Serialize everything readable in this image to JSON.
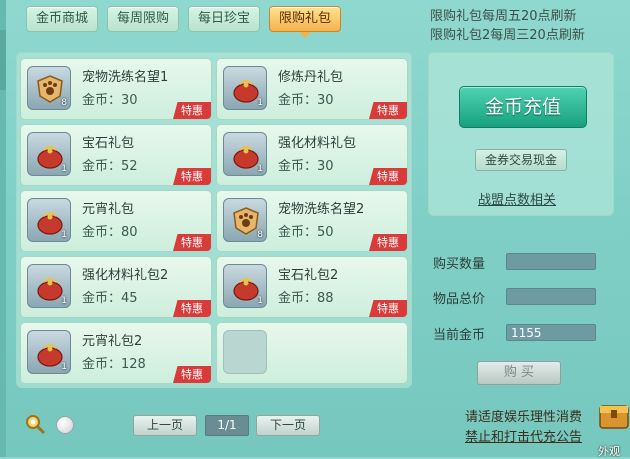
{
  "tabs": [
    {
      "label": "金币商城",
      "active": false
    },
    {
      "label": "每周限购",
      "active": false
    },
    {
      "label": "每日珍宝",
      "active": false
    },
    {
      "label": "限购礼包",
      "active": true
    }
  ],
  "notice": {
    "line1": "限购礼包每周五20点刷新",
    "line2": "限购礼包2每周三20点刷新"
  },
  "items": [
    {
      "name": "宠物洗练名望1",
      "price": "金币：30",
      "count": "8",
      "tag": "特惠",
      "icon": "pet-badge-icon"
    },
    {
      "name": "修炼丹礼包",
      "price": "金币：30",
      "count": "1",
      "tag": "特惠",
      "icon": "gift-bag-icon"
    },
    {
      "name": "宝石礼包",
      "price": "金币：52",
      "count": "1",
      "tag": "特惠",
      "icon": "gift-bag-icon"
    },
    {
      "name": "强化材料礼包",
      "price": "金币：30",
      "count": "1",
      "tag": "特惠",
      "icon": "gift-bag-icon"
    },
    {
      "name": "元宵礼包",
      "price": "金币：80",
      "count": "1",
      "tag": "特惠",
      "icon": "gift-bag-icon"
    },
    {
      "name": "宠物洗练名望2",
      "price": "金币：50",
      "count": "8",
      "tag": "特惠",
      "icon": "pet-badge-icon"
    },
    {
      "name": "强化材料礼包2",
      "price": "金币：45",
      "count": "1",
      "tag": "特惠",
      "icon": "gift-bag-icon"
    },
    {
      "name": "宝石礼包2",
      "price": "金币：88",
      "count": "1",
      "tag": "特惠",
      "icon": "gift-bag-icon"
    },
    {
      "name": "元宵礼包2",
      "price": "金币：128",
      "count": "1",
      "tag": "特惠",
      "icon": "gift-bag-icon"
    }
  ],
  "right_panel": {
    "recharge_label": "金币充值",
    "voucher_label": "金券交易现金",
    "league_label": "战盟点数相关"
  },
  "purchase": {
    "qty_label": "购买数量",
    "qty_value": "",
    "total_label": "物品总价",
    "total_value": "",
    "gold_label": "当前金币",
    "gold_value": "1155",
    "buy_label": "购 买"
  },
  "pager": {
    "prev_label": "上一页",
    "page_value": "1/1",
    "next_label": "下一页"
  },
  "advice": {
    "line1": "请适度娱乐理性消费",
    "line2": "禁止和打击代充公告"
  },
  "chest_label": "外观",
  "colors": {
    "background": "#7fcfc6",
    "active_tab": "#f3b24b",
    "tag_red": "#d93a3a",
    "recharge_green": "#17a07f"
  }
}
